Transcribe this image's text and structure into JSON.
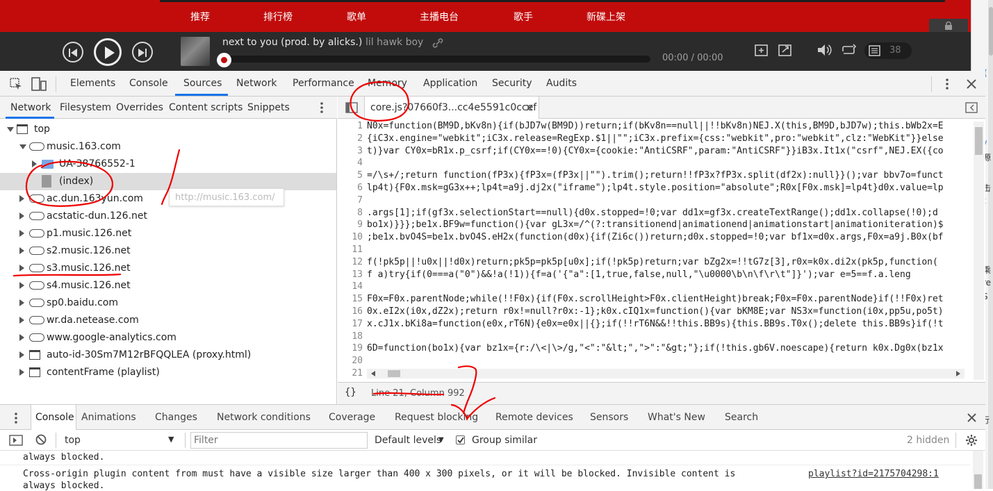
{
  "site_nav": {
    "items": [
      "推荐",
      "排行榜",
      "歌单",
      "主播电台",
      "歌手",
      "新碟上架"
    ]
  },
  "player": {
    "song_title": "next to you (prod. by alicks.)",
    "artist": "lil hawk boy",
    "time": "00:00 / 00:00",
    "playlist_count": "38"
  },
  "devtools": {
    "main_tabs": [
      "Elements",
      "Console",
      "Sources",
      "Network",
      "Performance",
      "Memory",
      "Application",
      "Security",
      "Audits"
    ],
    "active_main_tab": "Sources",
    "navigator_tabs": [
      "Network",
      "Filesystem",
      "Overrides",
      "Content scripts",
      "Snippets"
    ],
    "tree": [
      {
        "label": "top",
        "level": 0,
        "icon": "frame-icon",
        "expanded": true
      },
      {
        "label": "music.163.com",
        "level": 1,
        "icon": "cloud-icon",
        "expanded": true
      },
      {
        "label": "UA-38766552-1",
        "level": 2,
        "icon": "folder-icon",
        "expanded": false
      },
      {
        "label": "(index)",
        "level": 2,
        "icon": "file-icon",
        "selected": true
      },
      {
        "label": "ac.dun.163yun.com",
        "level": 1,
        "icon": "cloud-icon",
        "expanded": false
      },
      {
        "label": "acstatic-dun.126.net",
        "level": 1,
        "icon": "cloud-icon",
        "expanded": false
      },
      {
        "label": "p1.music.126.net",
        "level": 1,
        "icon": "cloud-icon",
        "expanded": false
      },
      {
        "label": "s2.music.126.net",
        "level": 1,
        "icon": "cloud-icon",
        "expanded": false
      },
      {
        "label": "s3.music.126.net",
        "level": 1,
        "icon": "cloud-icon",
        "expanded": false
      },
      {
        "label": "s4.music.126.net",
        "level": 1,
        "icon": "cloud-icon",
        "expanded": false
      },
      {
        "label": "sp0.baidu.com",
        "level": 1,
        "icon": "cloud-icon",
        "expanded": false
      },
      {
        "label": "wr.da.netease.com",
        "level": 1,
        "icon": "cloud-icon",
        "expanded": false
      },
      {
        "label": "www.google-analytics.com",
        "level": 1,
        "icon": "cloud-icon",
        "expanded": false
      },
      {
        "label": "auto-id-30Sm7M12rBFQQLEA (proxy.html)",
        "level": 1,
        "icon": "frame-icon",
        "expanded": false
      },
      {
        "label": "contentFrame (playlist)",
        "level": 1,
        "icon": "frame-icon",
        "expanded": false
      }
    ],
    "tooltip": "http://music.163.com/",
    "editor_tab": "core.js?07660f3...cc4e5591c0ccef",
    "code_lines": [
      {
        "n": "1",
        "t": "N0x=function(BM9D,bKv8n){if(bJD7w(BM9D))return;if(bKv8n==null||!!bKv8n)NEJ.X(this,BM9D,bJD7w);this.bWb2x=E"
      },
      {
        "n": "2",
        "t": "{iC3x.engine=\"webkit\";iC3x.release=RegExp.$1||\"\";iC3x.prefix={css:\"webkit\",pro:\"webkit\",clz:\"WebKit\"}}else"
      },
      {
        "n": "3",
        "t": "t)}var CY0x=bR1x.p_csrf;if(CY0x==!0){CY0x={cookie:\"AntiCSRF\",param:\"AntiCSRF\"}}iB3x.It1x(\"csrf\",NEJ.EX({co"
      },
      {
        "n": "4",
        "t": ""
      },
      {
        "n": "5",
        "t": "=/\\s+/;return function(fP3x){fP3x=(fP3x||\"\").trim();return!!fP3x?fP3x.split(df2x):null}}();var bbv7o=funct"
      },
      {
        "n": "6",
        "t": "lp4t){F0x.msk=gG3x++;lp4t=a9j.dj2x(\"iframe\");lp4t.style.position=\"absolute\";R0x[F0x.msk]=lp4t}d0x.value=lp"
      },
      {
        "n": "7",
        "t": ""
      },
      {
        "n": "8",
        "t": ".args[1];if(gf3x.selectionStart==null){d0x.stopped=!0;var dd1x=gf3x.createTextRange();dd1x.collapse(!0);d"
      },
      {
        "n": "9",
        "t": "bo1x)}}};be1x.BF9w=function(){var gL3x=/^(?:transitionend|animationend|animationstart|animationiteration)$"
      },
      {
        "n": "10",
        "t": ";be1x.bvO4S=be1x.bvO4S.eH2x(function(d0x){if(Zi6c())return;d0x.stopped=!0;var bf1x=d0x.args,F0x=a9j.B0x(bf"
      },
      {
        "n": "11",
        "t": ""
      },
      {
        "n": "12",
        "t": "f(!pk5p||!u0x||!d0x)return;pk5p=pk5p[u0x];if(!pk5p)return;var bZg2x=!!tG7z[3],r0x=k0x.di2x(pk5p,function("
      },
      {
        "n": "13",
        "t": "f a)try{if(0===a(\"0\")&&!a(!1)){f=a('{\"a\":[1,true,false,null,\"\\u0000\\b\\n\\f\\r\\t\"]}');var e=5==f.a.leng"
      },
      {
        "n": "14",
        "t": ""
      },
      {
        "n": "15",
        "t": "F0x=F0x.parentNode;while(!!F0x){if(F0x.scrollHeight>F0x.clientHeight)break;F0x=F0x.parentNode}if(!!F0x)ret"
      },
      {
        "n": "16",
        "t": "0x.eI2x(i0x,dZ2x);return r0x!=null?r0x:-1};k0x.cIQ1x=function(){var bKM8E;var NS3x=function(i0x,pp5u,po5t)"
      },
      {
        "n": "17",
        "t": "x.cJ1x.bKi8a=function(e0x,rT6N){e0x=e0x||{};if(!!rT6N&&!!this.BB9s){this.BB9s.T0x();delete this.BB9s}if(!t"
      },
      {
        "n": "18",
        "t": ""
      },
      {
        "n": "19",
        "t": "6D=function(bo1x){var bz1x={r:/\\<|\\>/g,\"<\":\"&lt;\",\">\":\"&gt;\"};if(!this.gb6V.noescape){return k0x.Dg0x(bz1x"
      },
      {
        "n": "20",
        "t": ""
      },
      {
        "n": "21",
        "t": ""
      }
    ],
    "status": "Line 21, Column 992"
  },
  "drawer": {
    "tabs": [
      "Console",
      "Animations",
      "Changes",
      "Network conditions",
      "Coverage",
      "Request blocking",
      "Remote devices",
      "Sensors",
      "What's New",
      "Search"
    ],
    "context": "top",
    "filter_placeholder": "Filter",
    "levels": "Default levels",
    "group_similar": "Group similar",
    "hidden": "2 hidden",
    "messages": [
      {
        "text": "always blocked."
      },
      {
        "text": "Cross-origin plugin content from  must have a visible size larger than 400 x 300 pixels, or it will be blocked. Invisible content is",
        "link": "playlist?id=2175704298:1"
      },
      {
        "text": "always blocked."
      }
    ]
  },
  "right_edge": {
    "glyphs": [
      "(",
      "∕",
      "源",
      "击",
      "t",
      "乘",
      "re",
      "S",
      "(",
      "行"
    ]
  }
}
